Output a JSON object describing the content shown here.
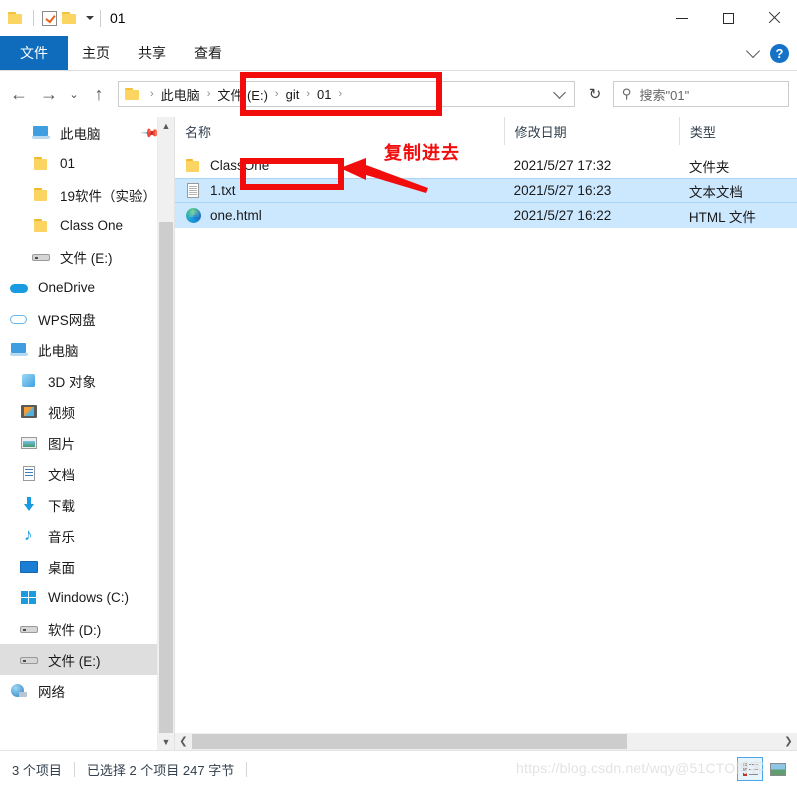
{
  "window": {
    "title": "01",
    "quick_access": [
      {
        "icon": "folder-icon",
        "name": "qat-folder"
      },
      {
        "icon": "properties-icon",
        "name": "qat-properties"
      },
      {
        "icon": "new-folder-icon",
        "name": "qat-new-folder"
      },
      {
        "icon": "chevron-down-icon",
        "name": "qat-customize"
      }
    ],
    "controls": {
      "minimize": "minimize-icon",
      "maximize": "maximize-icon",
      "close": "close-icon"
    }
  },
  "ribbon": {
    "tabs": [
      {
        "label": "文件",
        "active": true
      },
      {
        "label": "主页",
        "active": false
      },
      {
        "label": "共享",
        "active": false
      },
      {
        "label": "查看",
        "active": false
      }
    ],
    "collapse_icon": "chevron-down-icon",
    "help_label": "?"
  },
  "navigation": {
    "back": "back-arrow-icon",
    "forward": "forward-arrow-icon",
    "recent": "chevron-down-icon",
    "up": "up-arrow-icon",
    "refresh": "refresh-icon",
    "address": {
      "leading_icon": "folder-icon",
      "crumbs": [
        "此电脑",
        "文件 (E:)",
        "git",
        "01"
      ],
      "dropdown_icon": "chevron-down-icon"
    },
    "search": {
      "icon": "search-icon",
      "value": "搜索\"01\"",
      "placeholder": "搜索\"01\""
    }
  },
  "sidebar": {
    "items": [
      {
        "label": "此电脑",
        "icon": "pc-icon",
        "indent": 1,
        "pinned": true,
        "selected": false
      },
      {
        "label": "01",
        "icon": "folder-icon",
        "indent": 1,
        "pinned": false,
        "selected": false
      },
      {
        "label": "19软件（实验）",
        "icon": "folder-icon",
        "indent": 1,
        "pinned": false,
        "selected": false
      },
      {
        "label": "Class One",
        "icon": "folder-icon",
        "indent": 1,
        "pinned": false,
        "selected": false
      },
      {
        "label": "文件 (E:)",
        "icon": "drive-icon",
        "indent": 1,
        "pinned": false,
        "selected": false
      },
      {
        "label": "OneDrive",
        "icon": "onedrive-icon",
        "indent": 0,
        "pinned": false,
        "selected": false
      },
      {
        "label": "WPS网盘",
        "icon": "wps-cloud-icon",
        "indent": 0,
        "pinned": false,
        "selected": false
      },
      {
        "label": "此电脑",
        "icon": "pc-icon",
        "indent": 0,
        "pinned": false,
        "selected": false
      },
      {
        "label": "3D 对象",
        "icon": "3d-objects-icon",
        "indent": 2,
        "pinned": false,
        "selected": false
      },
      {
        "label": "视频",
        "icon": "videos-icon",
        "indent": 2,
        "pinned": false,
        "selected": false
      },
      {
        "label": "图片",
        "icon": "pictures-icon",
        "indent": 2,
        "pinned": false,
        "selected": false
      },
      {
        "label": "文档",
        "icon": "documents-icon",
        "indent": 2,
        "pinned": false,
        "selected": false
      },
      {
        "label": "下载",
        "icon": "downloads-icon",
        "indent": 2,
        "pinned": false,
        "selected": false
      },
      {
        "label": "音乐",
        "icon": "music-icon",
        "indent": 2,
        "pinned": false,
        "selected": false
      },
      {
        "label": "桌面",
        "icon": "desktop-icon",
        "indent": 2,
        "pinned": false,
        "selected": false
      },
      {
        "label": "Windows (C:)",
        "icon": "windows-drive-icon",
        "indent": 2,
        "pinned": false,
        "selected": false
      },
      {
        "label": "软件 (D:)",
        "icon": "drive-icon",
        "indent": 2,
        "pinned": false,
        "selected": false
      },
      {
        "label": "文件 (E:)",
        "icon": "drive-icon",
        "indent": 2,
        "pinned": false,
        "selected": true
      },
      {
        "label": "网络",
        "icon": "network-icon",
        "indent": 0,
        "pinned": false,
        "selected": false
      }
    ]
  },
  "filelist": {
    "columns": [
      {
        "label": "名称",
        "sorted": true
      },
      {
        "label": "修改日期",
        "sorted": false
      },
      {
        "label": "类型",
        "sorted": false
      }
    ],
    "rows": [
      {
        "name": "ClassOne",
        "date": "2021/5/27 17:32",
        "type": "文件夹",
        "icon": "folder-icon",
        "selected": false
      },
      {
        "name": "1.txt",
        "date": "2021/5/27 16:23",
        "type": "文本文档",
        "icon": "text-file-icon",
        "selected": true
      },
      {
        "name": "one.html",
        "date": "2021/5/27 16:22",
        "type": "HTML 文件",
        "icon": "edge-browser-icon",
        "selected": true
      }
    ]
  },
  "statusbar": {
    "item_count": "3 个项目",
    "selection": "已选择 2 个项目  247 字节",
    "view_details": "details-view-icon",
    "view_large": "large-icons-view-icon"
  },
  "annotations": {
    "copy_into_label": "复制进去",
    "accent_color": "#f20d0d"
  },
  "watermark": {
    "text": "https://blog.csdn.net/wqy@51CTO博客"
  }
}
